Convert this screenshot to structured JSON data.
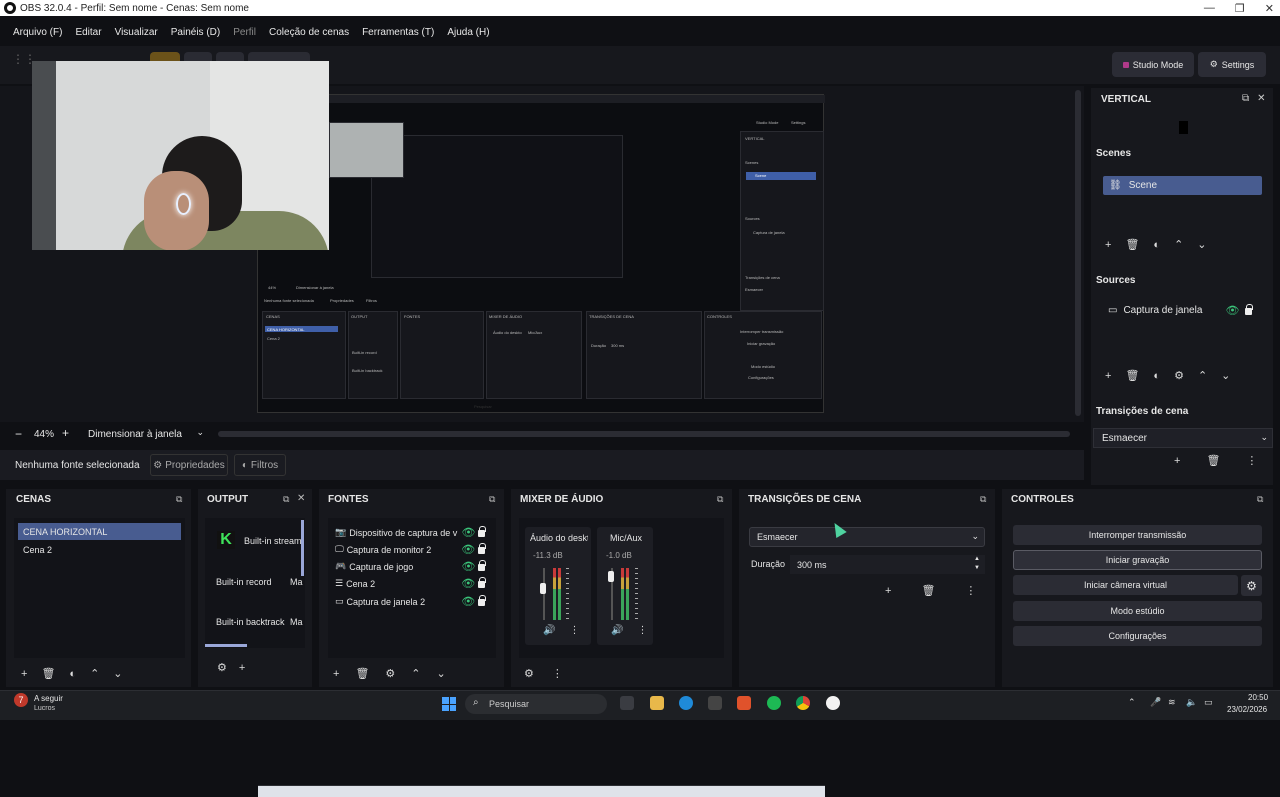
{
  "window": {
    "title": "OBS 32.0.4 - Perfil: Sem nome - Cenas: Sem nome"
  },
  "menu": {
    "items": [
      "Arquivo (F)",
      "Editar",
      "Visualizar",
      "Painéis (D)",
      "Perfil",
      "Coleção de cenas",
      "Ferramentas (T)",
      "Ajuda (H)"
    ],
    "disabled_index": 4
  },
  "toolbar": {
    "studio_mode": "Studio Mode",
    "settings": "Settings"
  },
  "preview": {
    "zoom": "44%",
    "scale_mode": "Dimensionar à janela",
    "no_source": "Nenhuma fonte selecionada",
    "properties": "Propriedades",
    "filters": "Filtros",
    "nested": {
      "labels": [
        "Studio Mode",
        "Settings",
        "VERTICAL",
        "Scenes",
        "Scene",
        "Sources",
        "Captura de janela",
        "Transições de cena",
        "Esmaecer",
        "CENAS",
        "OUTPUT",
        "FONTES",
        "MIXER DE ÁUDIO",
        "TRANSIÇÕES DE CENA",
        "CONTROLES",
        "CENA HORIZONTAL",
        "Cena 2",
        "Interromper transmissão",
        "Iniciar gravação",
        "Modo estúdio",
        "Configurações",
        "Pesquisar",
        "Nenhuma fonte selecionada",
        "Propriedades",
        "Filtros",
        "Dimensionar à janela",
        "44%",
        "Built-in record",
        "Built-in backtrack",
        "Áudio do deskto",
        "Mic/Aux",
        "Duração",
        "300 ms"
      ]
    }
  },
  "vertical": {
    "title": "VERTICAL",
    "scenes_label": "Scenes",
    "scene_item": "Scene",
    "sources_label": "Sources",
    "source_item": "Captura de janela",
    "transitions_label": "Transições de cena",
    "transition_value": "Esmaecer"
  },
  "docks": {
    "cenas": {
      "title": "CENAS",
      "items": [
        "CENA HORIZONTAL",
        "Cena 2"
      ]
    },
    "output": {
      "title": "OUTPUT",
      "stream": "Built-in stream",
      "record": "Built-in record",
      "record_tag": "Ma",
      "backtrack": "Built-in backtrack",
      "backtrack_tag": "Ma"
    },
    "fontes": {
      "title": "FONTES",
      "items": [
        "Dispositivo de captura de vídeo",
        "Captura de monitor 2",
        "Captura de jogo",
        "Cena 2",
        "Captura de janela 2"
      ]
    },
    "mixer": {
      "title": "MIXER DE ÁUDIO",
      "channels": [
        {
          "name": "Áudio do deskto",
          "db": "-11.3 dB"
        },
        {
          "name": "Mic/Aux",
          "db": "-1.0 dB"
        }
      ]
    },
    "transicoes": {
      "title": "TRANSIÇÕES DE CENA",
      "value": "Esmaecer",
      "duration_label": "Duração",
      "duration_value": "300 ms"
    },
    "controles": {
      "title": "CONTROLES",
      "buttons": [
        "Interromper transmissão",
        "Iniciar gravação",
        "Iniciar câmera virtual",
        "Modo estúdio",
        "Configurações"
      ]
    }
  },
  "taskbar": {
    "weather_title": "A seguir",
    "weather_sub": "Lucros",
    "search": "Pesquisar",
    "time": "20:50",
    "date": "23/02/2026"
  },
  "colors": {
    "accent": "#485c90",
    "eye": "#3bc47a"
  }
}
